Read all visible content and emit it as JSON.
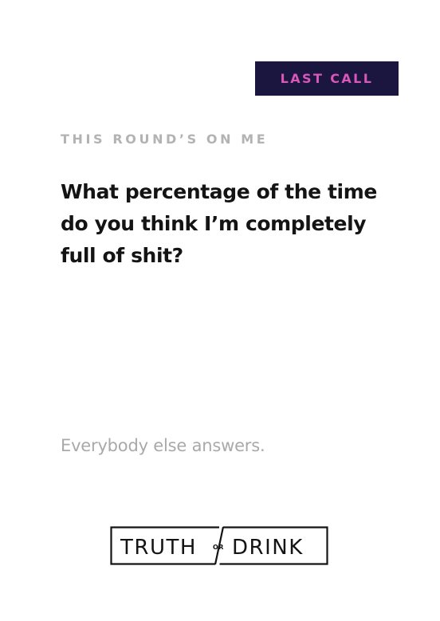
{
  "card": {
    "badge": "LAST CALL",
    "category": "THIS ROUND’S ON ME",
    "question": "What percentage of the time do you think I’m completely full of shit?",
    "instruction": "Everybody else answers."
  },
  "logo": {
    "word_left": "TRUTH",
    "word_connector": "OR",
    "word_right": "DRINK"
  },
  "colors": {
    "badge_background": "#1b1640",
    "badge_text": "#d957b8",
    "question_text": "#141414",
    "muted_text": "#b3b3b3"
  }
}
